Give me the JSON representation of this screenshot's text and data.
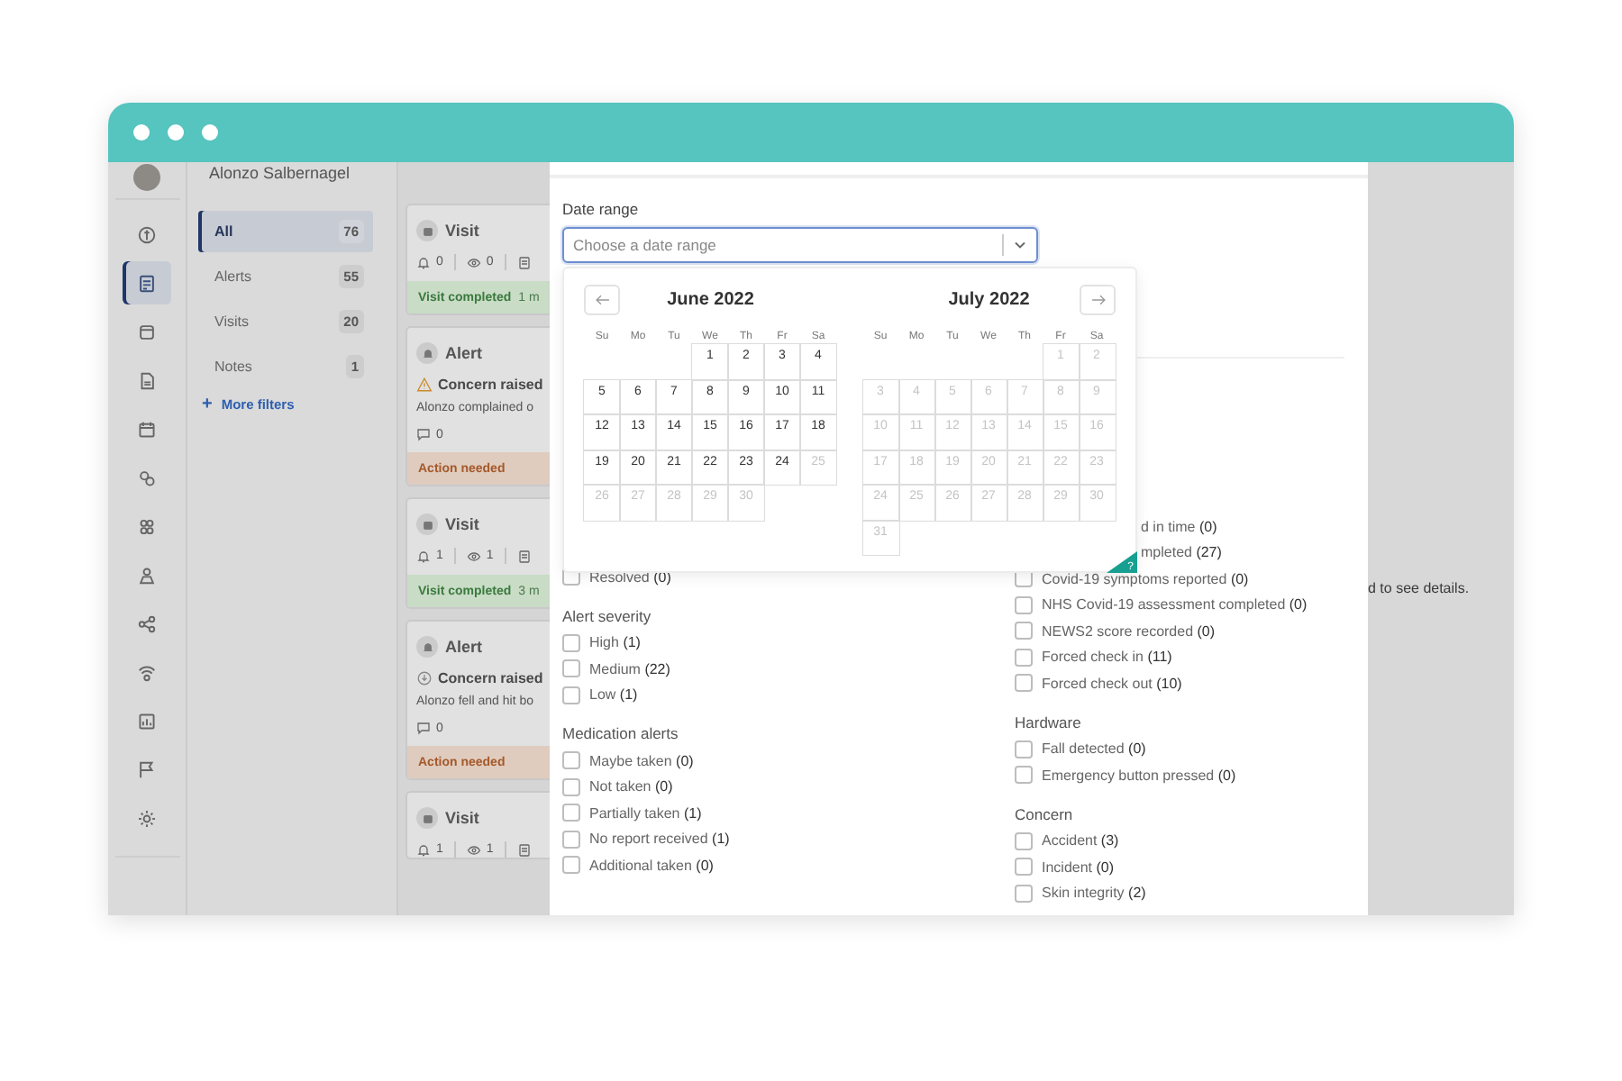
{
  "profile": {
    "name": "Alonzo Salbernagel"
  },
  "nav_rail": [
    {
      "selected": false
    },
    {
      "selected": true
    },
    {
      "selected": false
    },
    {
      "selected": false
    },
    {
      "selected": false
    },
    {
      "selected": false
    },
    {
      "selected": false
    },
    {
      "selected": false
    },
    {
      "selected": false
    },
    {
      "selected": false
    },
    {
      "selected": false
    },
    {
      "selected": false
    },
    {
      "selected": false
    }
  ],
  "filters": {
    "items": [
      {
        "label": "All",
        "count": "76",
        "selected": true
      },
      {
        "label": "Alerts",
        "count": "55",
        "selected": false
      },
      {
        "label": "Visits",
        "count": "20",
        "selected": false
      },
      {
        "label": "Notes",
        "count": "1",
        "selected": false
      }
    ],
    "more_icon": "+",
    "more_link": "More filters"
  },
  "feed": [
    {
      "kind": "visit",
      "title": "Visit",
      "stats": [
        "0",
        "0"
      ],
      "status": "Visit completed",
      "time": "1 m"
    },
    {
      "kind": "alert",
      "title": "Alert",
      "concern": {
        "kind": "warning",
        "text": "Concern raised"
      },
      "description": "Alonzo complained o",
      "comments": "0",
      "status": "Action needed"
    },
    {
      "kind": "visit",
      "title": "Visit",
      "stats": [
        "1",
        "1"
      ],
      "status": "Visit completed",
      "time": "3 m"
    },
    {
      "kind": "alert",
      "title": "Alert",
      "concern": {
        "kind": "info",
        "text": "Concern raised"
      },
      "description": "Alonzo fell and hit bo",
      "comments": "0",
      "status": "Action needed"
    },
    {
      "kind": "visit",
      "title": "Visit",
      "stats": [
        "1",
        "1"
      ]
    }
  ],
  "filter_panel": {
    "date_range": {
      "label": "Date range",
      "placeholder": "Choose a date range"
    },
    "calendar": {
      "months": [
        {
          "kind": "prev",
          "title": "June 2022",
          "weekdays": [
            "Su",
            "Mo",
            "Tu",
            "We",
            "Th",
            "Fr",
            "Sa"
          ],
          "weeks": [
            [
              {
                "label": "1",
                "disabled": false
              },
              {
                "label": "2",
                "disabled": false
              },
              {
                "label": "3",
                "disabled": false
              },
              {
                "label": "4",
                "disabled": false
              }
            ],
            [
              {
                "label": "5",
                "disabled": false
              },
              {
                "label": "6",
                "disabled": false
              },
              {
                "label": "7",
                "disabled": false
              },
              {
                "label": "8",
                "disabled": false
              },
              {
                "label": "9",
                "disabled": false
              },
              {
                "label": "10",
                "disabled": false
              },
              {
                "label": "11",
                "disabled": false
              }
            ],
            [
              {
                "label": "12",
                "disabled": false
              },
              {
                "label": "13",
                "disabled": false
              },
              {
                "label": "14",
                "disabled": false
              },
              {
                "label": "15",
                "disabled": false
              },
              {
                "label": "16",
                "disabled": false
              },
              {
                "label": "17",
                "disabled": false
              },
              {
                "label": "18",
                "disabled": false
              }
            ],
            [
              {
                "label": "19",
                "disabled": false
              },
              {
                "label": "20",
                "disabled": false
              },
              {
                "label": "21",
                "disabled": false
              },
              {
                "label": "22",
                "disabled": false
              },
              {
                "label": "23",
                "disabled": false
              },
              {
                "label": "24",
                "disabled": false
              },
              {
                "label": "25",
                "disabled": true
              }
            ],
            [
              {
                "label": "26",
                "disabled": true
              },
              {
                "label": "27",
                "disabled": true
              },
              {
                "label": "28",
                "disabled": true
              },
              {
                "label": "29",
                "disabled": true
              },
              {
                "label": "30",
                "disabled": true
              }
            ]
          ]
        },
        {
          "kind": "next",
          "title": "July 2022",
          "weekdays": [
            "Su",
            "Mo",
            "Tu",
            "We",
            "Th",
            "Fr",
            "Sa"
          ],
          "weeks": [
            [
              {
                "label": "1",
                "disabled": true
              },
              {
                "label": "2",
                "disabled": true
              }
            ],
            [
              {
                "label": "3",
                "disabled": true
              },
              {
                "label": "4",
                "disabled": true
              },
              {
                "label": "5",
                "disabled": true
              },
              {
                "label": "6",
                "disabled": true
              },
              {
                "label": "7",
                "disabled": true
              },
              {
                "label": "8",
                "disabled": true
              },
              {
                "label": "9",
                "disabled": true
              }
            ],
            [
              {
                "label": "10",
                "disabled": true
              },
              {
                "label": "11",
                "disabled": true
              },
              {
                "label": "12",
                "disabled": true
              },
              {
                "label": "13",
                "disabled": true
              },
              {
                "label": "14",
                "disabled": true
              },
              {
                "label": "15",
                "disabled": true
              },
              {
                "label": "16",
                "disabled": true
              }
            ],
            [
              {
                "label": "17",
                "disabled": true
              },
              {
                "label": "18",
                "disabled": true
              },
              {
                "label": "19",
                "disabled": true
              },
              {
                "label": "20",
                "disabled": true
              },
              {
                "label": "21",
                "disabled": true
              },
              {
                "label": "22",
                "disabled": true
              },
              {
                "label": "23",
                "disabled": true
              }
            ],
            [
              {
                "label": "24",
                "disabled": true
              },
              {
                "label": "25",
                "disabled": true
              },
              {
                "label": "26",
                "disabled": true
              },
              {
                "label": "27",
                "disabled": true
              },
              {
                "label": "28",
                "disabled": true
              },
              {
                "label": "29",
                "disabled": true
              },
              {
                "label": "30",
                "disabled": true
              }
            ],
            [
              {
                "label": "31",
                "disabled": true
              }
            ]
          ]
        }
      ],
      "help": "?"
    },
    "left_groups": [
      {
        "items": [
          {
            "kind": "checkbox",
            "label": "Resolved",
            "count": "(0)",
            "checked": false
          }
        ]
      },
      {
        "title": "Alert severity",
        "items": [
          {
            "kind": "checkbox",
            "label": "High",
            "count": "(1)",
            "checked": false
          },
          {
            "kind": "checkbox",
            "label": "Medium",
            "count": "(22)",
            "checked": false
          },
          {
            "kind": "checkbox",
            "label": "Low",
            "count": "(1)",
            "checked": false
          }
        ]
      },
      {
        "title": "Medication alerts",
        "items": [
          {
            "kind": "checkbox",
            "label": "Maybe taken",
            "count": "(0)",
            "checked": false
          },
          {
            "kind": "checkbox",
            "label": "Not taken",
            "count": "(0)",
            "checked": false
          },
          {
            "kind": "checkbox",
            "label": "Partially taken",
            "count": "(1)",
            "checked": false
          },
          {
            "kind": "checkbox",
            "label": "No report received",
            "count": "(1)",
            "checked": false
          },
          {
            "kind": "checkbox",
            "label": "Additional taken",
            "count": "(0)",
            "checked": false
          }
        ]
      }
    ],
    "right_groups": [
      {
        "items": [
          {
            "kind": "partial",
            "label": "d in time",
            "count": "(0)"
          },
          {
            "kind": "partial",
            "label": "mpleted",
            "count": "(27)"
          },
          {
            "kind": "checkbox",
            "label": "Covid-19 symptoms reported",
            "count": "(0)",
            "checked": false
          },
          {
            "kind": "checkbox",
            "label": "NHS Covid-19 assessment completed",
            "count": "(0)",
            "checked": false
          },
          {
            "kind": "checkbox",
            "label": "NEWS2 score recorded",
            "count": "(0)",
            "checked": false
          },
          {
            "kind": "checkbox",
            "label": "Forced check in",
            "count": "(11)",
            "checked": false
          },
          {
            "kind": "checkbox",
            "label": "Forced check out",
            "count": "(10)",
            "checked": false
          }
        ]
      },
      {
        "title": "Hardware",
        "items": [
          {
            "kind": "checkbox",
            "label": "Fall detected",
            "count": "(0)",
            "checked": false
          },
          {
            "kind": "checkbox",
            "label": "Emergency button pressed",
            "count": "(0)",
            "checked": false
          }
        ]
      },
      {
        "title": "Concern",
        "items": [
          {
            "kind": "checkbox",
            "label": "Accident",
            "count": "(3)",
            "checked": false
          },
          {
            "kind": "checkbox",
            "label": "Incident",
            "count": "(0)",
            "checked": false
          },
          {
            "kind": "checkbox",
            "label": "Skin integrity",
            "count": "(2)",
            "checked": false
          }
        ]
      }
    ]
  },
  "detail_hint": "d to see details."
}
